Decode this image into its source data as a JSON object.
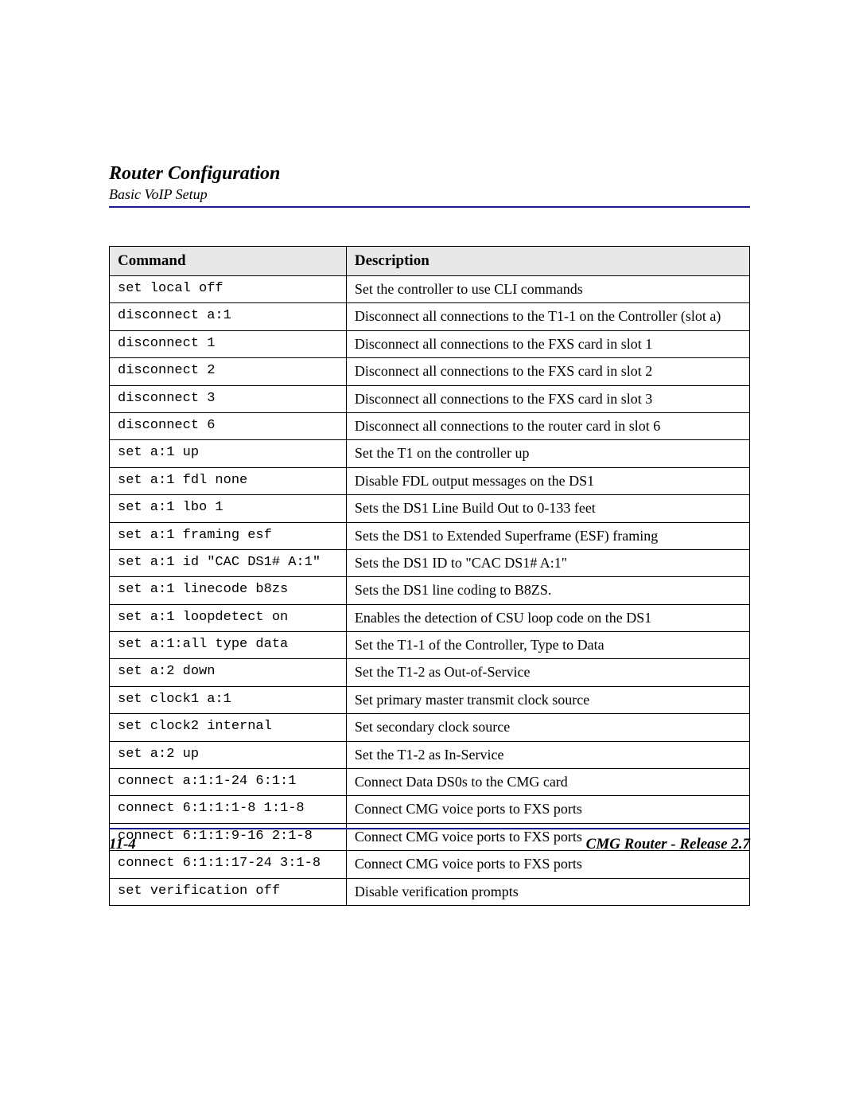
{
  "header": {
    "title": "Router Configuration",
    "subtitle": "Basic VoIP Setup"
  },
  "table": {
    "headers": {
      "command": "Command",
      "description": "Description"
    },
    "rows": [
      {
        "command": "set local off",
        "description": "Set the controller to use CLI commands"
      },
      {
        "command": "disconnect a:1",
        "description": "Disconnect all connections to the T1-1 on the Controller (slot a)"
      },
      {
        "command": "disconnect 1",
        "description": "Disconnect all connections to the FXS card in slot 1"
      },
      {
        "command": "disconnect 2",
        "description": "Disconnect all connections to the FXS card in slot 2"
      },
      {
        "command": "disconnect 3",
        "description": "Disconnect all connections to the FXS card in slot 3"
      },
      {
        "command": "disconnect 6",
        "description": "Disconnect all connections to the router card in slot 6"
      },
      {
        "command": "set a:1 up",
        "description": "Set the T1 on the controller up"
      },
      {
        "command": "set a:1 fdl none",
        "description": "Disable FDL output messages on the DS1"
      },
      {
        "command": "set a:1 lbo 1",
        "description": "Sets the DS1 Line Build Out to 0-133 feet"
      },
      {
        "command": "set a:1 framing esf",
        "description": "Sets the DS1 to Extended Superframe (ESF) framing"
      },
      {
        "command": "set a:1 id \"CAC DS1# A:1\"",
        "description": "Sets the DS1 ID to \"CAC DS1# A:1\""
      },
      {
        "command": "set a:1 linecode b8zs",
        "description": "Sets the DS1 line coding to B8ZS."
      },
      {
        "command": "set a:1 loopdetect on",
        "description": "Enables the detection of CSU loop code on the DS1"
      },
      {
        "command": "set a:1:all type data",
        "description": "Set the T1-1 of the Controller, Type to Data"
      },
      {
        "command": "set a:2 down",
        "description": "Set the T1-2 as Out-of-Service"
      },
      {
        "command": "set clock1 a:1",
        "description": "Set primary master transmit clock source"
      },
      {
        "command": "set clock2 internal",
        "description": "Set secondary clock source"
      },
      {
        "command": "set a:2 up",
        "description": "Set the T1-2 as In-Service"
      },
      {
        "command": "connect a:1:1-24 6:1:1",
        "description": "Connect Data DS0s to the CMG card"
      },
      {
        "command": "connect 6:1:1:1-8 1:1-8",
        "description": "Connect CMG voice ports to FXS ports"
      },
      {
        "command": "connect 6:1:1:9-16 2:1-8",
        "description": "Connect CMG voice ports to FXS ports"
      },
      {
        "command": "connect 6:1:1:17-24 3:1-8",
        "description": "Connect CMG voice ports to FXS ports"
      },
      {
        "command": "set verification off",
        "description": "Disable verification prompts"
      }
    ]
  },
  "footer": {
    "page": "11-4",
    "product": "CMG Router - Release 2.7"
  }
}
